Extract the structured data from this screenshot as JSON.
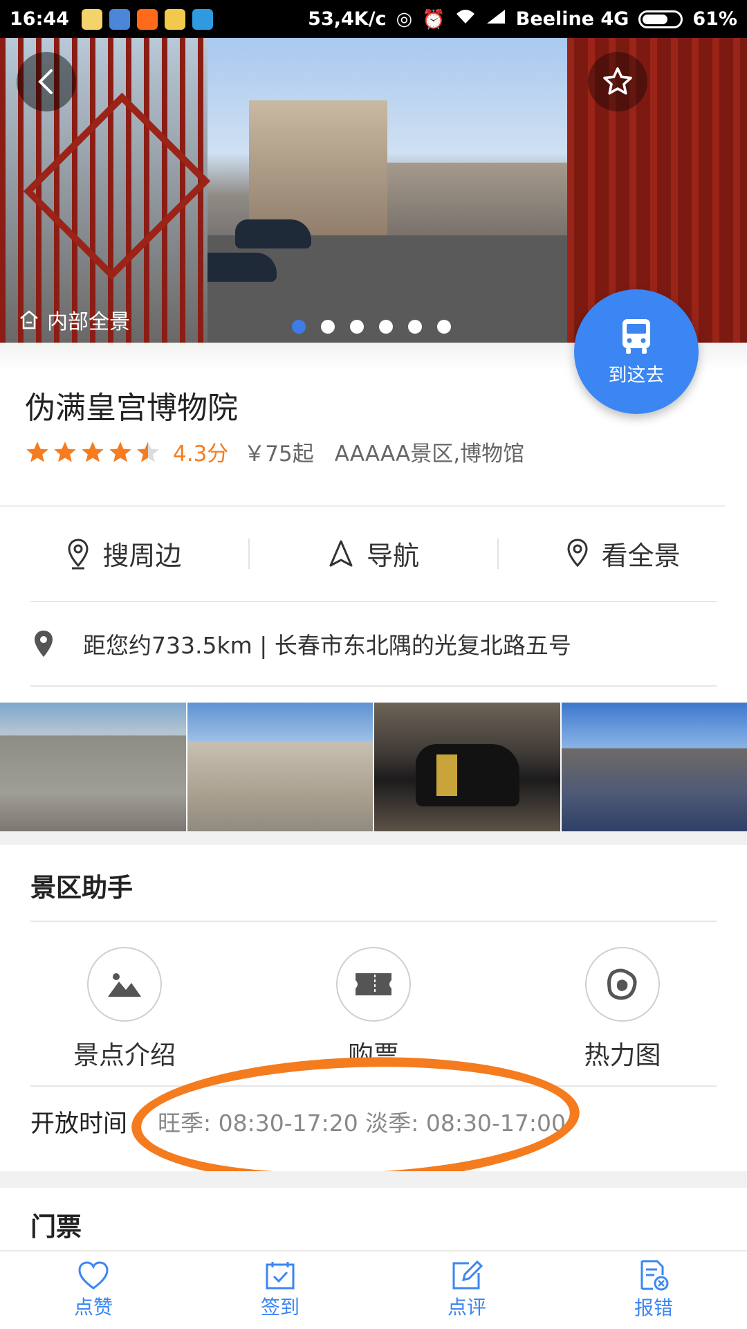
{
  "status_bar": {
    "time": "16:44",
    "speed": "53,4K/c",
    "carrier": "Beeline 4G",
    "battery": "61%"
  },
  "hero": {
    "panorama_label": "内部全景",
    "page_count": 6,
    "active_page": 1,
    "go_label": "到这去"
  },
  "place": {
    "name": "伪满皇宫博物院",
    "rating_stars": 4.5,
    "score": "4.3分",
    "price": "￥75起",
    "tags": "AAAAA景区,博物馆"
  },
  "actions": [
    {
      "label": "搜周边",
      "icon": "location-pin-icon"
    },
    {
      "label": "导航",
      "icon": "navigation-arrow-icon"
    },
    {
      "label": "看全景",
      "icon": "panorama-pin-icon"
    }
  ],
  "address": "距您约733.5km | 长春市东北隅的光复北路五号",
  "assistant": {
    "title": "景区助手",
    "tools": [
      {
        "label": "景点介绍",
        "icon": "landscape-icon"
      },
      {
        "label": "购票",
        "icon": "ticket-icon"
      },
      {
        "label": "热力图",
        "icon": "heatmap-icon"
      }
    ],
    "hours_label": "开放时间",
    "hours_value": "旺季: 08:30-17:20 淡季: 08:30-17:00"
  },
  "tickets_title": "门票",
  "bottom_nav": [
    {
      "label": "点赞",
      "icon": "heart-icon"
    },
    {
      "label": "签到",
      "icon": "checkin-calendar-icon"
    },
    {
      "label": "点评",
      "icon": "edit-review-icon"
    },
    {
      "label": "报错",
      "icon": "report-error-icon"
    }
  ],
  "colors": {
    "accent_blue": "#3b86f2",
    "score_orange": "#f57c1f",
    "annotation_orange": "#f47b1e"
  }
}
